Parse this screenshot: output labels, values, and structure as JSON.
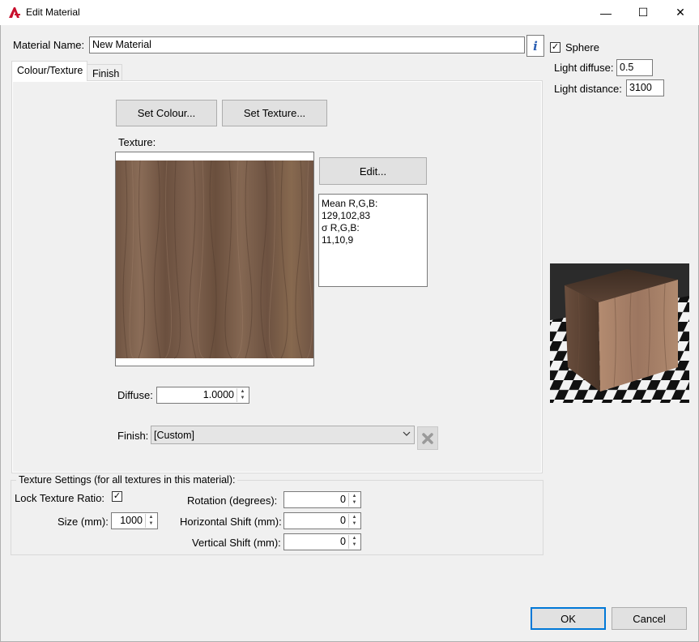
{
  "window": {
    "title": "Edit Material",
    "minimize_glyph": "—",
    "maximize_glyph": "☐",
    "close_glyph": "✕"
  },
  "material_name": {
    "label": "Material Name:",
    "value": "New Material",
    "info_glyph": "i"
  },
  "tabs": [
    {
      "label": "Colour/Texture",
      "active": true
    },
    {
      "label": "Finish",
      "active": false
    }
  ],
  "colour_texture": {
    "set_colour_label": "Set Colour...",
    "set_texture_label": "Set Texture...",
    "texture_label": "Texture:",
    "edit_label": "Edit...",
    "stats": {
      "mean_label": "Mean R,G,B:",
      "mean_value": "129,102,83",
      "sigma_label": "σ R,G,B:",
      "sigma_value": "11,10,9"
    },
    "diffuse_label": "Diffuse:",
    "diffuse_value": "1.0000",
    "finish_label": "Finish:",
    "finish_value": "[Custom]"
  },
  "texture_settings": {
    "group_title": "Texture Settings (for all textures in this material):",
    "lock_ratio_label": "Lock Texture Ratio:",
    "lock_ratio_checked": true,
    "size_label": "Size (mm):",
    "size_value": "1000",
    "rotation_label": "Rotation (degrees):",
    "rotation_value": "0",
    "hshift_label": "Horizontal Shift (mm):",
    "hshift_value": "0",
    "vshift_label": "Vertical Shift (mm):",
    "vshift_value": "0"
  },
  "preview_panel": {
    "sphere_label": "Sphere",
    "sphere_checked": true,
    "light_diffuse_label": "Light diffuse:",
    "light_diffuse_value": "0.5",
    "light_distance_label": "Light distance:",
    "light_distance_value": "3100"
  },
  "footer": {
    "ok_label": "OK",
    "cancel_label": "Cancel"
  },
  "colors": {
    "wood": "#7a5f4b",
    "accent": "#0078d7",
    "app_icon": "#c8102e"
  }
}
